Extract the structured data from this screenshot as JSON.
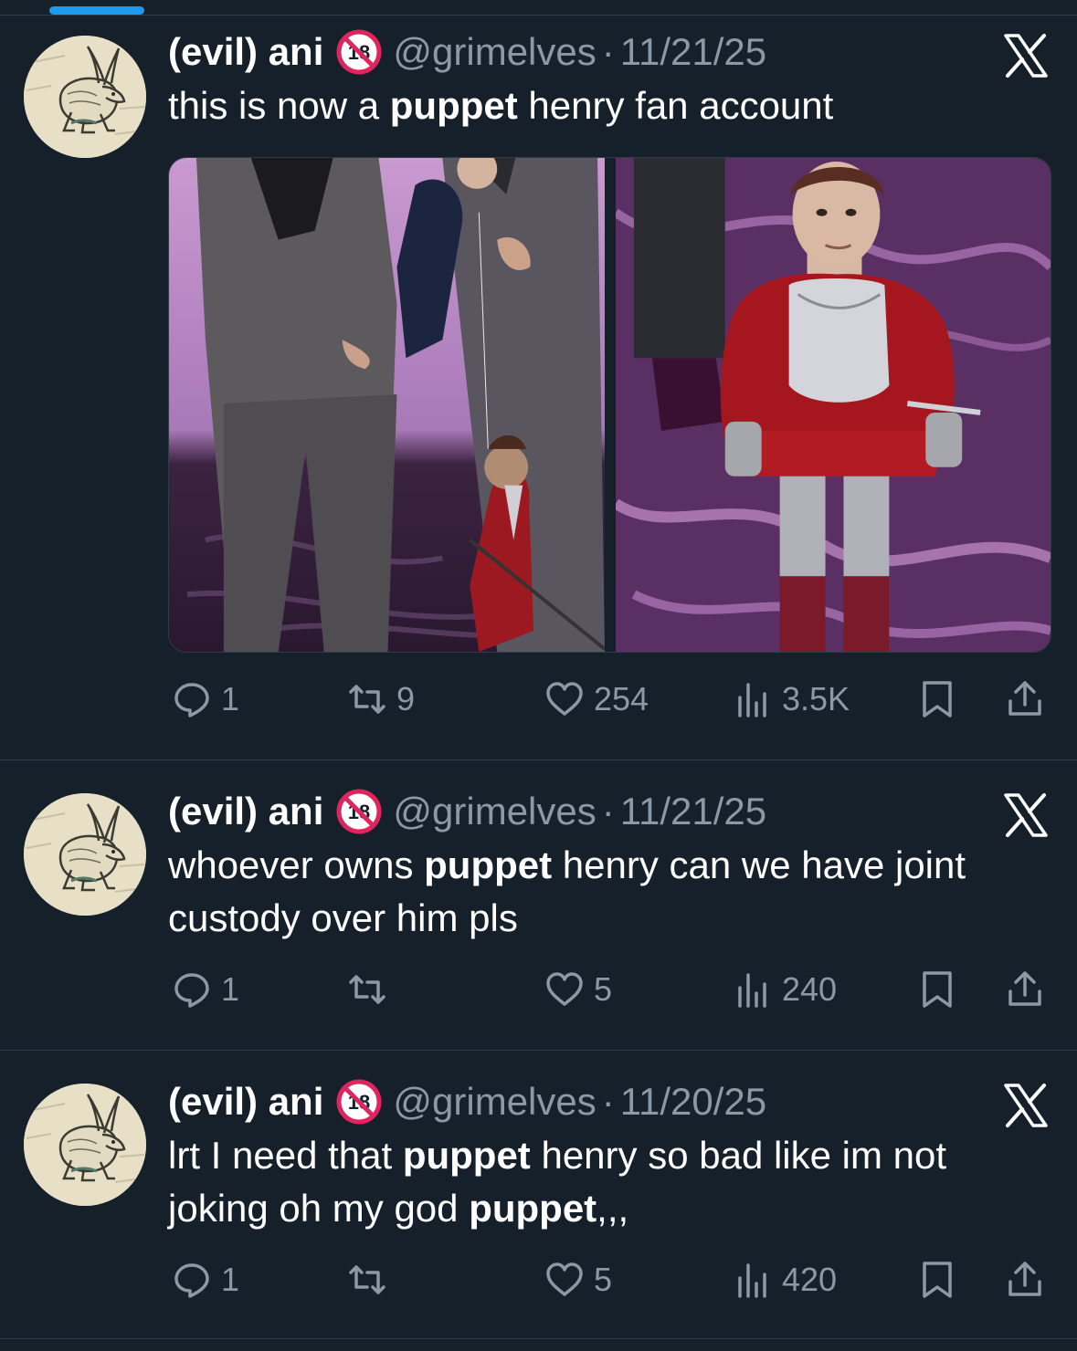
{
  "colors": {
    "background": "#15202b",
    "accent": "#1d9bf0",
    "muted_text": "#8b98a5",
    "divider": "#2f3b47"
  },
  "tweets": [
    {
      "display_name": "(evil) ani",
      "handle": "@grimelves",
      "separator": "·",
      "date": "11/21/25",
      "text_parts": [
        "this is now a ",
        "puppet",
        " henry fan account"
      ],
      "has_media": true,
      "media": [
        "photo-man-in-suit-with-marionette",
        "photo-puppet-henry-in-armor"
      ],
      "reply_count": "1",
      "retweet_count": "9",
      "like_count": "254",
      "view_count": "3.5K"
    },
    {
      "display_name": "(evil) ani",
      "handle": "@grimelves",
      "separator": "·",
      "date": "11/21/25",
      "text_parts": [
        "whoever owns ",
        "puppet",
        " henry can we have joint custody over him pls"
      ],
      "has_media": false,
      "reply_count": "1",
      "retweet_count": "",
      "like_count": "5",
      "view_count": "240"
    },
    {
      "display_name": "(evil) ani",
      "handle": "@grimelves",
      "separator": "·",
      "date": "11/20/25",
      "text_parts": [
        "lrt I need that ",
        "puppet",
        " henry so bad like im not joking oh my god ",
        "puppet",
        ",,,"
      ],
      "has_media": false,
      "reply_count": "1",
      "retweet_count": "",
      "like_count": "5",
      "view_count": "420"
    }
  ],
  "icons": {
    "avatar": "rabbit-drawing",
    "badge": "no-under-18-icon",
    "source": "x-logo-icon",
    "reply": "speech-bubble-icon",
    "retweet": "retweet-arrows-icon",
    "like": "heart-icon",
    "views": "bar-chart-icon",
    "bookmark": "bookmark-icon",
    "share": "share-upload-icon"
  }
}
